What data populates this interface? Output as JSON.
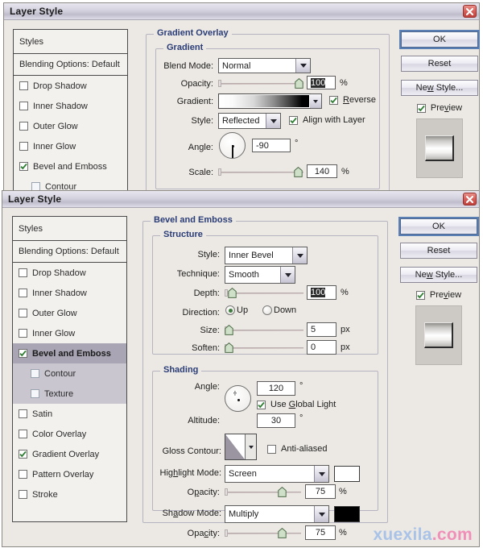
{
  "window_title": "Layer Style",
  "close_icon": "close-x-icon",
  "buttons": {
    "ok": "OK",
    "reset": "Reset",
    "new_style": "New Style...",
    "preview": "Preview"
  },
  "styles_list": {
    "header": "Styles",
    "blending_options": "Blending Options: Default",
    "items": [
      {
        "label": "Drop Shadow",
        "checked": false
      },
      {
        "label": "Inner Shadow",
        "checked": false
      },
      {
        "label": "Outer Glow",
        "checked": false
      },
      {
        "label": "Inner Glow",
        "checked": false
      },
      {
        "label": "Bevel and Emboss",
        "checked": true
      },
      {
        "label": "Contour",
        "checked": false
      },
      {
        "label": "Texture",
        "checked": false
      },
      {
        "label": "Satin",
        "checked": false
      },
      {
        "label": "Color Overlay",
        "checked": false
      },
      {
        "label": "Gradient Overlay",
        "checked": true
      },
      {
        "label": "Pattern Overlay",
        "checked": false
      },
      {
        "label": "Stroke",
        "checked": false
      }
    ]
  },
  "dialog1": {
    "panel_title": "Gradient Overlay",
    "group_title": "Gradient",
    "blend_mode_label": "Blend Mode:",
    "blend_mode_value": "Normal",
    "opacity_label": "Opacity:",
    "opacity_value": "100",
    "opacity_unit": "%",
    "gradient_label": "Gradient:",
    "reverse_label": "Reverse",
    "reverse_checked": true,
    "style_label": "Style:",
    "style_value": "Reflected",
    "align_label": "Align with Layer",
    "align_checked": true,
    "angle_label": "Angle:",
    "angle_value": "-90",
    "degree_unit": "°",
    "scale_label": "Scale:",
    "scale_value": "140",
    "scale_unit": "%"
  },
  "dialog2": {
    "panel_title": "Bevel and Emboss",
    "structure": {
      "title": "Structure",
      "style_label": "Style:",
      "style_value": "Inner Bevel",
      "technique_label": "Technique:",
      "technique_value": "Smooth",
      "depth_label": "Depth:",
      "depth_value": "100",
      "depth_unit": "%",
      "direction_label": "Direction:",
      "direction_up": "Up",
      "direction_down": "Down",
      "direction_selected": "Up",
      "size_label": "Size:",
      "size_value": "5",
      "size_unit": "px",
      "soften_label": "Soften:",
      "soften_value": "0",
      "soften_unit": "px"
    },
    "shading": {
      "title": "Shading",
      "angle_label": "Angle:",
      "angle_value": "120",
      "degree_unit": "°",
      "use_global_light": "Use Global Light",
      "use_global_light_checked": true,
      "altitude_label": "Altitude:",
      "altitude_value": "30",
      "gloss_contour_label": "Gloss Contour:",
      "anti_aliased_label": "Anti-aliased",
      "anti_aliased_checked": false,
      "highlight_mode_label": "Highlight Mode:",
      "highlight_mode_value": "Screen",
      "highlight_color": "#ffffff",
      "highlight_opacity_label": "Opacity:",
      "highlight_opacity_value": "75",
      "highlight_opacity_unit": "%",
      "shadow_mode_label": "Shadow Mode:",
      "shadow_mode_value": "Multiply",
      "shadow_color": "#000000",
      "shadow_opacity_label": "Opacity:",
      "shadow_opacity_value": "75",
      "shadow_opacity_unit": "%"
    }
  },
  "watermark": {
    "site": "xuexila",
    "tld": ".com"
  },
  "colors": {
    "accent": "#2b3d77",
    "selection": "#a9a5b4",
    "close": "#c0403c",
    "slider_thumb": "#8fb08a"
  }
}
